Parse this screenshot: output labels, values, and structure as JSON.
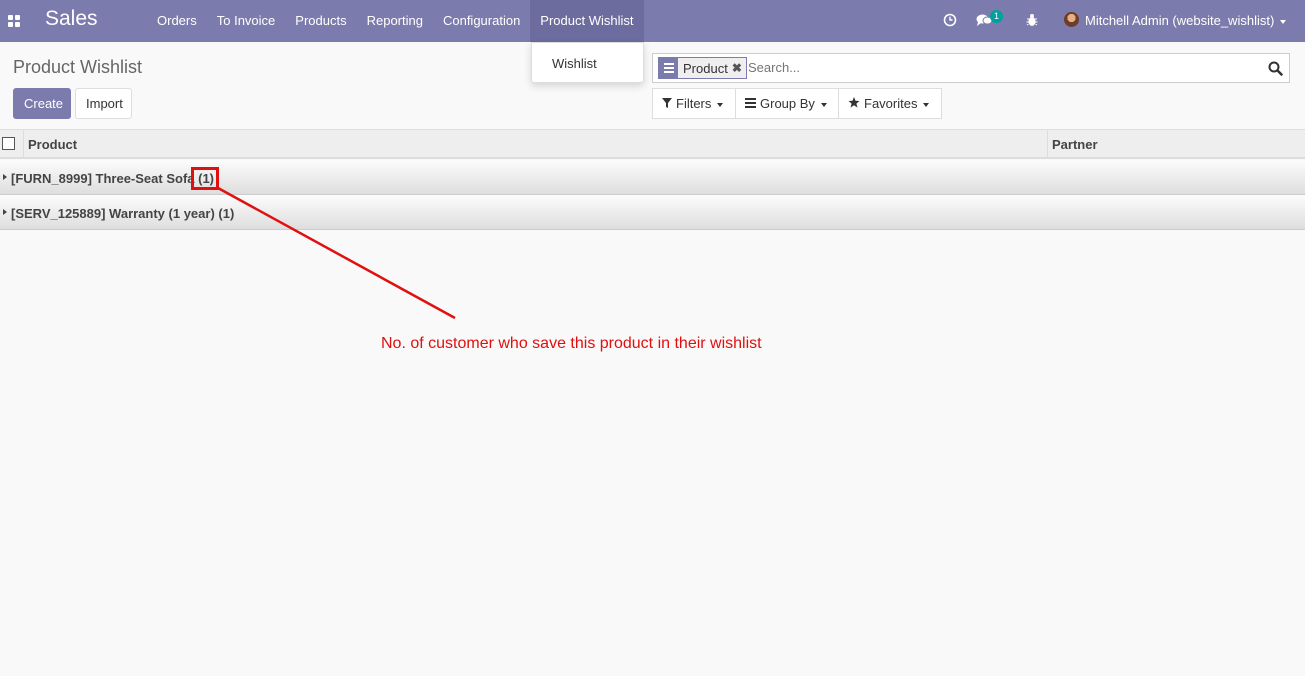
{
  "navbar": {
    "brand": "Sales",
    "menu": [
      "Orders",
      "To Invoice",
      "Products",
      "Reporting",
      "Configuration",
      "Product Wishlist"
    ],
    "active_menu": "Product Wishlist",
    "message_count": "1",
    "user": "Mitchell Admin (website_wishlist)"
  },
  "dropdown": {
    "items": [
      "Wishlist"
    ]
  },
  "control_panel": {
    "title": "Product Wishlist",
    "create_label": "Create",
    "import_label": "Import",
    "search": {
      "facet": "Product",
      "placeholder": "Search..."
    },
    "filters_label": "Filters",
    "group_by_label": "Group By",
    "favorites_label": "Favorites"
  },
  "list": {
    "columns": [
      "Product",
      "Partner"
    ],
    "groups": [
      {
        "label": "[FURN_8999] Three-Seat Sofa",
        "count": "(1)"
      },
      {
        "label": "[SERV_125889] Warranty (1 year)",
        "count": "(1)"
      }
    ]
  },
  "annotation": {
    "text": "No. of customer who save this product in their wishlist"
  },
  "colors": {
    "navbar": "#7c7bad",
    "primary": "#7c7bad",
    "annotation": "#e01010",
    "badge": "#00a09d"
  }
}
